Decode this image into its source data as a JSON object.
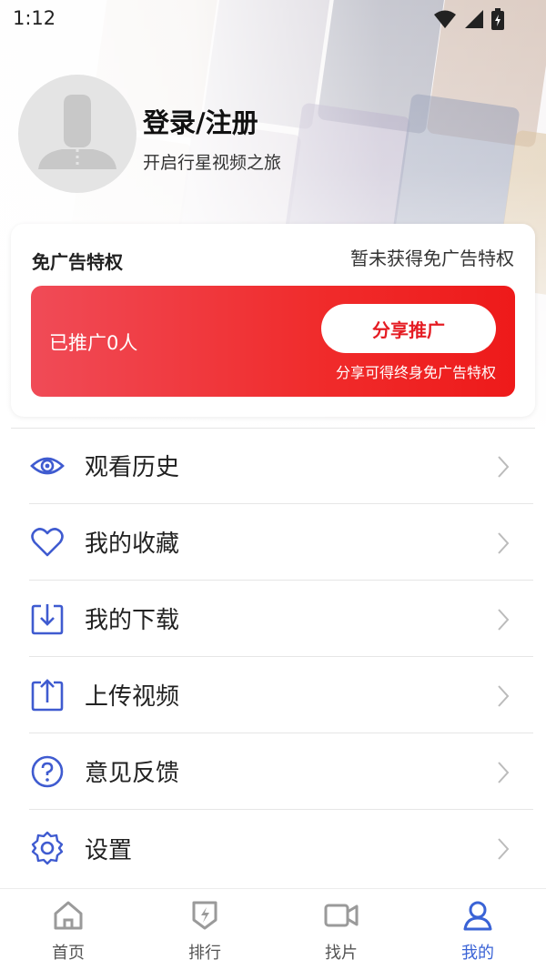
{
  "status_bar": {
    "time": "1:12"
  },
  "profile": {
    "title": "登录/注册",
    "subtitle": "开启行星视频之旅"
  },
  "ad_card": {
    "title": "免广告特权",
    "status": "暂未获得免广告特权",
    "promoted": "已推广0人",
    "share_button": "分享推广",
    "share_hint": "分享可得终身免广告特权"
  },
  "menu": {
    "items": [
      {
        "label": "观看历史",
        "icon": "eye-icon"
      },
      {
        "label": "我的收藏",
        "icon": "heart-icon"
      },
      {
        "label": "我的下载",
        "icon": "download-icon"
      },
      {
        "label": "上传视频",
        "icon": "upload-icon"
      },
      {
        "label": "意见反馈",
        "icon": "question-icon"
      },
      {
        "label": "设置",
        "icon": "gear-icon"
      }
    ]
  },
  "bottom_nav": {
    "items": [
      {
        "label": "首页",
        "icon": "home-icon"
      },
      {
        "label": "排行",
        "icon": "ranking-icon"
      },
      {
        "label": "找片",
        "icon": "video-camera-icon"
      },
      {
        "label": "我的",
        "icon": "user-icon",
        "active": true
      }
    ]
  },
  "colors": {
    "accent": "#3a63d6",
    "menu_icon": "#3f5bd0",
    "banner_red": "#f02b2b",
    "share_text": "#e51c23"
  }
}
